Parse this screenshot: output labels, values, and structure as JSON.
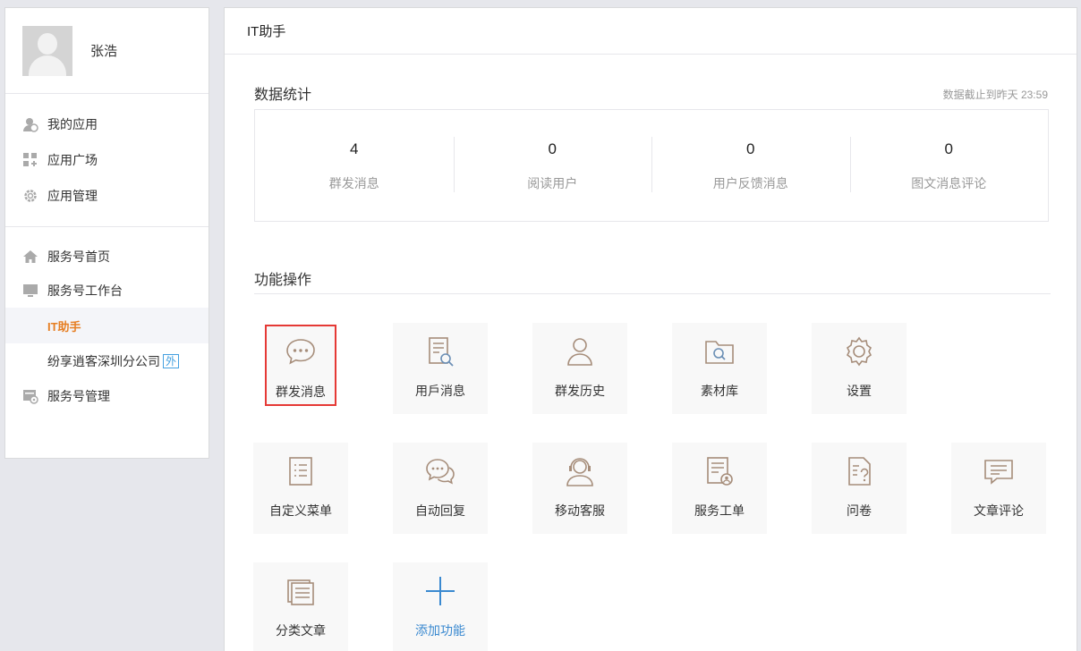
{
  "sidebar": {
    "profile_name": "张浩",
    "group1": [
      {
        "label": "我的应用",
        "icon": "my-apps-icon"
      },
      {
        "label": "应用广场",
        "icon": "app-square-icon"
      },
      {
        "label": "应用管理",
        "icon": "app-manage-gear-icon"
      }
    ],
    "group2": {
      "home": {
        "label": "服务号首页",
        "icon": "home-icon"
      },
      "workbench": {
        "label": "服务号工作台",
        "icon": "monitor-icon"
      },
      "active_sub": "IT助手",
      "sub2": "纷享逍客深圳分公司",
      "sub2_badge": "外",
      "manage": {
        "label": "服务号管理",
        "icon": "service-manage-icon"
      }
    }
  },
  "main": {
    "header_title": "IT助手",
    "stats_title": "数据统计",
    "stats_note": "数据截止到昨天 23:59",
    "stats": [
      {
        "value": "4",
        "label": "群发消息"
      },
      {
        "value": "0",
        "label": "阅读用户"
      },
      {
        "value": "0",
        "label": "用户反馈消息"
      },
      {
        "value": "0",
        "label": "图文消息评论"
      }
    ],
    "functions_title": "功能操作",
    "functions": [
      {
        "label": "群发消息",
        "icon": "chat-bubble-icon"
      },
      {
        "label": "用戶消息",
        "icon": "document-search-icon"
      },
      {
        "label": "群发历史",
        "icon": "user-icon"
      },
      {
        "label": "素材库",
        "icon": "folder-search-icon"
      },
      {
        "label": "设置",
        "icon": "gear-icon"
      },
      {
        "label": "自定义菜单",
        "icon": "list-icon"
      },
      {
        "label": "自动回复",
        "icon": "auto-reply-icon"
      },
      {
        "label": "移动客服",
        "icon": "headset-agent-icon"
      },
      {
        "label": "服务工单",
        "icon": "work-order-icon"
      },
      {
        "label": "问卷",
        "icon": "questionnaire-icon"
      },
      {
        "label": "文章评论",
        "icon": "comment-icon"
      },
      {
        "label": "分类文章",
        "icon": "category-article-icon"
      },
      {
        "label": "添加功能",
        "icon": "plus-icon"
      }
    ]
  },
  "colors": {
    "active_nav": "#e67e22",
    "add_blue": "#3a89d0",
    "highlight_red": "#e53935",
    "icon_tan": "#a68d7a"
  }
}
